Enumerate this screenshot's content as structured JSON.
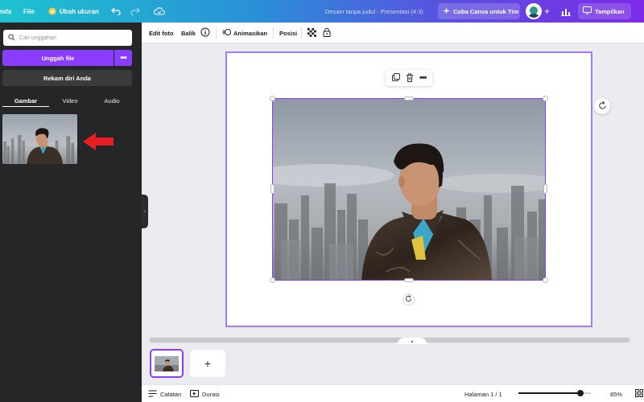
{
  "topbar": {
    "home_label": "nda",
    "file_label": "File",
    "resize_label": "Ubah ukuran",
    "doc_title": "Desain tanpa judul - Presentasi (4:3)",
    "try_team_label": "Coba Canva untuk Tim",
    "share_label": "Tampilkan"
  },
  "left_panel": {
    "search_placeholder": "Cari unggahan",
    "upload_label": "Unggah file",
    "upload_more": "•••",
    "record_label": "Rekam diri Anda",
    "tabs": [
      {
        "label": "Gambar",
        "active": true
      },
      {
        "label": "Video",
        "active": false
      },
      {
        "label": "Audio",
        "active": false
      }
    ]
  },
  "toolbar": {
    "edit_photo": "Edit foto",
    "flip": "Balik",
    "animate": "Animasikan",
    "position": "Posisi"
  },
  "bottombar": {
    "notes": "Catatan",
    "duration": "Durasi",
    "page_indicator": "Halaman 1 / 1",
    "zoom": "85%",
    "zoom_fraction": 0.85
  },
  "pages": {
    "add_label": "+"
  },
  "colors": {
    "accent": "#8b3dff",
    "panel": "#252627",
    "arrow": "#e81e25"
  }
}
